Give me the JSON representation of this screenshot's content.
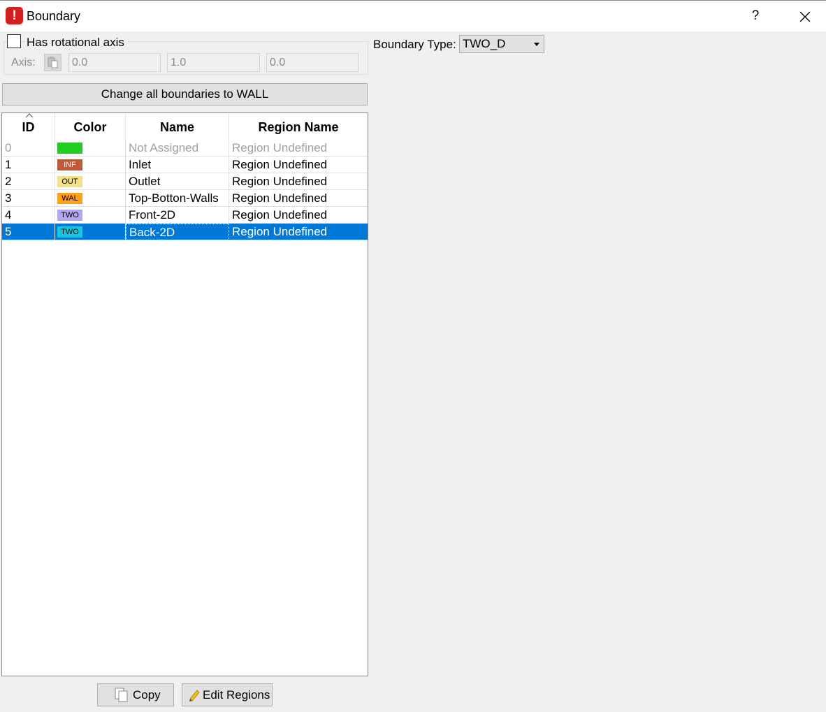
{
  "window": {
    "title": "Boundary",
    "help_label": "?",
    "app_icon_glyph": "!"
  },
  "rotation": {
    "checkbox_label": "Has rotational axis",
    "checked": false,
    "axis_label": "Axis:",
    "axis_values": [
      "0.0",
      "1.0",
      "0.0"
    ]
  },
  "boundary_type": {
    "label": "Boundary Type:",
    "selected": "TWO_D"
  },
  "change_all_button": "Change all boundaries to WALL",
  "table": {
    "columns": [
      "ID",
      "Color",
      "Name",
      "Region Name"
    ],
    "rows": [
      {
        "id": "0",
        "swatch_label": "",
        "swatch_color": "#22cc22",
        "name": "Not Assigned",
        "region": "Region Undefined"
      },
      {
        "id": "1",
        "swatch_label": "INF",
        "swatch_color": "#c0583a",
        "name": "Inlet",
        "region": "Region Undefined"
      },
      {
        "id": "2",
        "swatch_label": "OUT",
        "swatch_color": "#f5e08a",
        "name": "Outlet",
        "region": "Region Undefined"
      },
      {
        "id": "3",
        "swatch_label": "WAL",
        "swatch_color": "#ff9f1a",
        "name": "Top-Botton-Walls",
        "region": "Region Undefined"
      },
      {
        "id": "4",
        "swatch_label": "TWO",
        "swatch_color": "#b3a6f0",
        "name": "Front-2D",
        "region": "Region Undefined"
      },
      {
        "id": "5",
        "swatch_label": "TWO",
        "swatch_color": "#19c6e0",
        "name": "Back-2D",
        "region": "Region Undefined"
      }
    ],
    "selected_row": "5"
  },
  "buttons": {
    "copy": "Copy",
    "edit_regions": "Edit Regions"
  },
  "colors": {
    "selection": "#0078d7",
    "app_icon": "#d21f1f"
  }
}
